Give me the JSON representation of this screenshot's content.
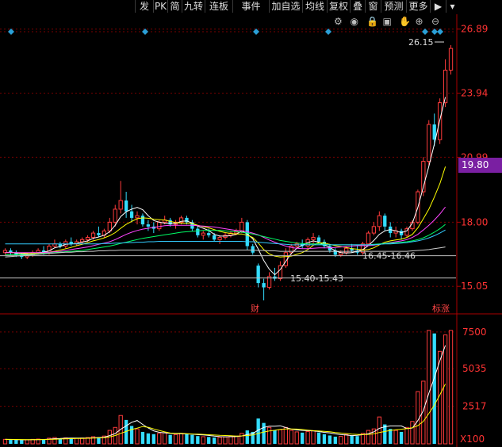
{
  "toolbar": {
    "buttons": [
      "发",
      "PK",
      "简",
      "九转",
      "连板",
      "事件",
      "加自选",
      "均线",
      "复权",
      "叠",
      "窗",
      "预测",
      "更多"
    ],
    "tools": [
      "gear-icon",
      "eye-icon",
      "lock-icon",
      "save-icon",
      "hand-icon",
      "zoom-in-icon",
      "zoom-out-icon"
    ]
  },
  "price_axis": {
    "labels": [
      "26.89",
      "23.94",
      "20.99",
      "18.00",
      "15.05"
    ],
    "current_price": "19.80"
  },
  "volume_axis": {
    "labels": [
      "7500",
      "5035",
      "2517"
    ],
    "unit": "X100"
  },
  "annotations": {
    "high": "26.15",
    "gap_upper": "16.45-16.46",
    "gap_lower": "15.40-15.43",
    "event_mark_1": "财",
    "event_mark_2": "标涨"
  },
  "colors": {
    "up": "#ff3b3b",
    "down": "#33ddff",
    "grid": "#8a0000",
    "ma5": "#ffffff",
    "ma10": "#ffff00",
    "ma20": "#ff44ff",
    "ma30": "#00ff66",
    "ma60": "#33ccff",
    "ma120": "#cccccc"
  },
  "chart_data": {
    "type": "candlestick",
    "ylim": [
      14.0,
      27.5
    ],
    "volume_ylim": [
      0,
      8500
    ],
    "candles": [
      [
        16.6,
        16.8,
        16.5,
        16.7
      ],
      [
        16.7,
        16.8,
        16.5,
        16.6
      ],
      [
        16.6,
        16.7,
        16.4,
        16.5
      ],
      [
        16.5,
        16.6,
        16.3,
        16.4
      ],
      [
        16.4,
        16.6,
        16.3,
        16.5
      ],
      [
        16.5,
        16.7,
        16.4,
        16.6
      ],
      [
        16.6,
        16.8,
        16.5,
        16.7
      ],
      [
        16.7,
        16.9,
        16.5,
        16.6
      ],
      [
        16.6,
        17.0,
        16.5,
        16.9
      ],
      [
        16.9,
        17.2,
        16.8,
        17.0
      ],
      [
        17.0,
        17.1,
        16.8,
        16.9
      ],
      [
        16.9,
        17.2,
        16.8,
        17.1
      ],
      [
        17.1,
        17.3,
        16.9,
        17.0
      ],
      [
        17.0,
        17.2,
        16.9,
        17.1
      ],
      [
        17.1,
        17.3,
        17.0,
        17.2
      ],
      [
        17.2,
        17.4,
        17.1,
        17.3
      ],
      [
        17.3,
        17.6,
        17.2,
        17.5
      ],
      [
        17.5,
        17.8,
        17.3,
        17.4
      ],
      [
        17.4,
        17.7,
        17.3,
        17.6
      ],
      [
        17.6,
        18.2,
        17.5,
        18.0
      ],
      [
        18.0,
        18.8,
        17.8,
        18.6
      ],
      [
        18.6,
        19.9,
        18.4,
        19.0
      ],
      [
        19.0,
        19.4,
        18.2,
        18.5
      ],
      [
        18.5,
        18.8,
        18.0,
        18.2
      ],
      [
        18.2,
        18.5,
        17.9,
        18.3
      ],
      [
        18.3,
        18.4,
        17.8,
        17.9
      ],
      [
        17.9,
        18.1,
        17.6,
        17.8
      ],
      [
        17.8,
        18.0,
        17.5,
        17.7
      ],
      [
        17.7,
        18.1,
        17.6,
        18.0
      ],
      [
        18.0,
        18.3,
        17.9,
        18.1
      ],
      [
        18.1,
        18.2,
        17.8,
        17.9
      ],
      [
        17.9,
        18.1,
        17.7,
        18.0
      ],
      [
        18.0,
        18.3,
        17.9,
        18.2
      ],
      [
        18.2,
        18.3,
        17.9,
        18.0
      ],
      [
        18.0,
        18.1,
        17.6,
        17.7
      ],
      [
        17.7,
        17.8,
        17.3,
        17.4
      ],
      [
        17.4,
        17.6,
        17.2,
        17.5
      ],
      [
        17.5,
        17.7,
        17.3,
        17.4
      ],
      [
        17.4,
        17.5,
        17.1,
        17.2
      ],
      [
        17.2,
        17.4,
        17.0,
        17.3
      ],
      [
        17.3,
        17.5,
        17.2,
        17.4
      ],
      [
        17.4,
        17.6,
        17.3,
        17.5
      ],
      [
        17.5,
        17.7,
        17.4,
        17.6
      ],
      [
        17.6,
        18.2,
        17.5,
        18.0
      ],
      [
        18.0,
        18.1,
        16.7,
        16.9
      ],
      [
        16.9,
        17.0,
        16.5,
        16.6
      ],
      [
        16.0,
        16.1,
        15.0,
        15.2
      ],
      [
        15.2,
        15.4,
        14.4,
        15.0
      ],
      [
        15.0,
        15.7,
        14.9,
        15.5
      ],
      [
        15.5,
        15.9,
        15.3,
        15.4
      ],
      [
        15.4,
        16.2,
        15.3,
        16.0
      ],
      [
        16.0,
        16.8,
        15.9,
        16.6
      ],
      [
        16.6,
        17.0,
        16.5,
        16.9
      ],
      [
        16.9,
        17.1,
        16.8,
        17.0
      ],
      [
        17.0,
        17.2,
        16.8,
        16.9
      ],
      [
        16.9,
        17.3,
        16.8,
        17.2
      ],
      [
        17.2,
        17.5,
        17.0,
        17.3
      ],
      [
        17.3,
        17.4,
        17.0,
        17.1
      ],
      [
        17.1,
        17.2,
        16.8,
        16.9
      ],
      [
        16.9,
        17.0,
        16.6,
        16.7
      ],
      [
        16.7,
        16.8,
        16.4,
        16.5
      ],
      [
        16.5,
        16.7,
        16.4,
        16.6
      ],
      [
        16.6,
        16.9,
        16.5,
        16.8
      ],
      [
        16.8,
        17.0,
        16.6,
        16.7
      ],
      [
        16.7,
        16.9,
        16.5,
        16.6
      ],
      [
        16.6,
        17.1,
        16.5,
        17.0
      ],
      [
        17.0,
        17.6,
        16.9,
        17.5
      ],
      [
        17.5,
        18.0,
        17.4,
        17.8
      ],
      [
        17.8,
        18.5,
        17.6,
        18.3
      ],
      [
        18.3,
        18.4,
        17.6,
        17.8
      ],
      [
        17.8,
        18.0,
        17.3,
        17.5
      ],
      [
        17.5,
        17.8,
        17.3,
        17.6
      ],
      [
        17.6,
        17.7,
        17.2,
        17.4
      ],
      [
        17.4,
        17.8,
        17.3,
        17.7
      ],
      [
        17.7,
        18.1,
        17.6,
        18.0
      ],
      [
        18.0,
        19.5,
        17.9,
        19.4
      ],
      [
        19.4,
        21.0,
        19.2,
        20.8
      ],
      [
        20.8,
        22.7,
        20.6,
        22.5
      ],
      [
        22.5,
        23.0,
        21.5,
        21.8
      ],
      [
        21.8,
        23.7,
        21.6,
        23.5
      ],
      [
        23.5,
        25.5,
        23.3,
        25.0
      ],
      [
        25.0,
        26.15,
        24.8,
        26.0
      ]
    ],
    "volumes": [
      300,
      280,
      260,
      250,
      270,
      300,
      320,
      310,
      380,
      420,
      360,
      400,
      350,
      370,
      390,
      420,
      480,
      450,
      520,
      900,
      1100,
      1900,
      1600,
      1200,
      1000,
      800,
      700,
      650,
      700,
      750,
      600,
      620,
      700,
      650,
      600,
      520,
      480,
      460,
      420,
      440,
      460,
      500,
      520,
      700,
      900,
      800,
      1700,
      1400,
      1100,
      900,
      950,
      1100,
      900,
      800,
      750,
      820,
      880,
      760,
      640,
      560,
      480,
      500,
      620,
      560,
      520,
      700,
      900,
      1000,
      1800,
      1300,
      1000,
      900,
      800,
      1100,
      1500,
      3500,
      4200,
      7600,
      7400,
      6200,
      7300,
      7600
    ],
    "ma_series": [
      {
        "color": "#ffffff",
        "values": [
          16.6,
          16.62,
          16.58,
          16.54,
          16.54,
          16.56,
          16.6,
          16.62,
          16.68,
          16.82,
          16.88,
          16.98,
          17.0,
          17.02,
          17.08,
          17.14,
          17.26,
          17.32,
          17.4,
          17.56,
          17.86,
          18.26,
          18.48,
          18.6,
          18.68,
          18.58,
          18.3,
          18.08,
          18.0,
          17.96,
          17.94,
          17.94,
          18.04,
          18.06,
          17.96,
          17.82,
          17.72,
          17.62,
          17.44,
          17.36,
          17.36,
          17.38,
          17.44,
          17.6,
          17.46,
          17.24,
          16.76,
          16.24,
          15.84,
          15.58,
          15.82,
          16.2,
          16.56,
          16.8,
          16.94,
          17.06,
          17.14,
          17.08,
          16.96,
          16.84,
          16.68,
          16.6,
          16.58,
          16.6,
          16.66,
          16.74,
          16.92,
          17.16,
          17.44,
          17.6,
          17.66,
          17.6,
          17.52,
          17.6,
          17.96,
          18.68,
          19.62,
          20.58,
          21.6,
          22.72,
          23.76
        ]
      },
      {
        "color": "#ffff00",
        "values": [
          16.6,
          16.6,
          16.6,
          16.58,
          16.56,
          16.56,
          16.58,
          16.6,
          16.62,
          16.66,
          16.72,
          16.78,
          16.84,
          16.92,
          16.98,
          17.06,
          17.14,
          17.2,
          17.28,
          17.38,
          17.52,
          17.72,
          17.9,
          18.04,
          18.16,
          18.2,
          18.18,
          18.14,
          18.12,
          18.1,
          18.04,
          17.98,
          17.96,
          17.96,
          17.94,
          17.86,
          17.8,
          17.74,
          17.66,
          17.58,
          17.52,
          17.48,
          17.46,
          17.46,
          17.4,
          17.3,
          17.04,
          16.74,
          16.54,
          16.44,
          16.4,
          16.42,
          16.44,
          16.52,
          16.6,
          16.74,
          16.94,
          17.06,
          17.04,
          16.98,
          16.92,
          16.88,
          16.84,
          16.78,
          16.76,
          16.72,
          16.74,
          16.82,
          16.96,
          17.08,
          17.14,
          17.18,
          17.22,
          17.3,
          17.44,
          17.74,
          18.16,
          18.6,
          19.16,
          19.78,
          20.56
        ]
      },
      {
        "color": "#ff44ff",
        "values": [
          16.6,
          16.6,
          16.6,
          16.6,
          16.6,
          16.6,
          16.6,
          16.6,
          16.62,
          16.64,
          16.66,
          16.7,
          16.74,
          16.78,
          16.82,
          16.86,
          16.92,
          16.98,
          17.04,
          17.1,
          17.2,
          17.32,
          17.44,
          17.54,
          17.62,
          17.68,
          17.72,
          17.76,
          17.8,
          17.84,
          17.86,
          17.86,
          17.86,
          17.86,
          17.86,
          17.84,
          17.82,
          17.8,
          17.78,
          17.74,
          17.7,
          17.66,
          17.62,
          17.6,
          17.56,
          17.5,
          17.42,
          17.3,
          17.18,
          17.08,
          16.98,
          16.9,
          16.84,
          16.8,
          16.78,
          16.78,
          16.8,
          16.82,
          16.82,
          16.82,
          16.84,
          16.86,
          16.88,
          16.9,
          16.92,
          16.92,
          16.92,
          16.94,
          16.98,
          17.02,
          17.06,
          17.1,
          17.14,
          17.2,
          17.3,
          17.44,
          17.64,
          17.86,
          18.1,
          18.38,
          18.7
        ]
      },
      {
        "color": "#00ff66",
        "values": [
          16.5,
          16.5,
          16.5,
          16.5,
          16.5,
          16.52,
          16.54,
          16.56,
          16.58,
          16.6,
          16.62,
          16.64,
          16.66,
          16.68,
          16.7,
          16.74,
          16.78,
          16.82,
          16.86,
          16.9,
          16.96,
          17.02,
          17.08,
          17.14,
          17.2,
          17.26,
          17.3,
          17.34,
          17.38,
          17.42,
          17.46,
          17.5,
          17.54,
          17.56,
          17.58,
          17.6,
          17.62,
          17.62,
          17.62,
          17.62,
          17.6,
          17.58,
          17.56,
          17.54,
          17.5,
          17.46,
          17.4,
          17.34,
          17.28,
          17.22,
          17.16,
          17.12,
          17.08,
          17.04,
          17.02,
          17.0,
          17.0,
          17.0,
          16.98,
          16.96,
          16.96,
          16.96,
          16.96,
          16.96,
          16.96,
          16.96,
          16.96,
          16.98,
          17.0,
          17.02,
          17.04,
          17.06,
          17.08,
          17.1,
          17.14,
          17.2,
          17.28,
          17.4,
          17.54,
          17.7,
          17.9
        ]
      },
      {
        "color": "#33ccff",
        "values": [
          17.0,
          17.0,
          17.0,
          17.0,
          17.0,
          17.0,
          17.0,
          17.0,
          17.0,
          17.0,
          17.0,
          17.0,
          17.0,
          17.0,
          17.0,
          17.0,
          17.0,
          17.0,
          17.02,
          17.02,
          17.04,
          17.04,
          17.06,
          17.06,
          17.08,
          17.08,
          17.1,
          17.1,
          17.12,
          17.12,
          17.12,
          17.12,
          17.12,
          17.12,
          17.12,
          17.12,
          17.12,
          17.12,
          17.12,
          17.12,
          17.12,
          17.12,
          17.12,
          17.12,
          17.1,
          17.1,
          17.08,
          17.06,
          17.04,
          17.02,
          17.0,
          16.98,
          16.96,
          16.96,
          16.96,
          16.96,
          16.96,
          16.96,
          16.96,
          16.96,
          16.96,
          16.96,
          16.96,
          16.96,
          16.96,
          16.96,
          16.96,
          16.96,
          16.98,
          17.0,
          17.0,
          17.02,
          17.04,
          17.06,
          17.1,
          17.14,
          17.2,
          17.28,
          17.38,
          17.5,
          17.64
        ]
      },
      {
        "color": "#cccccc",
        "values": [
          16.4,
          16.42,
          16.44,
          16.46,
          16.48,
          16.5,
          16.52,
          16.54,
          16.56,
          16.58,
          16.6,
          16.62,
          16.62,
          16.64,
          16.64,
          16.66,
          16.66,
          16.68,
          16.68,
          16.7,
          16.7,
          16.72,
          16.72,
          16.72,
          16.72,
          16.72,
          16.72,
          16.72,
          16.72,
          16.72,
          16.72,
          16.72,
          16.72,
          16.72,
          16.72,
          16.72,
          16.72,
          16.72,
          16.72,
          16.72,
          16.72,
          16.72,
          16.72,
          16.72,
          16.72,
          16.72,
          16.7,
          16.7,
          16.68,
          16.68,
          16.66,
          16.66,
          16.66,
          16.66,
          16.66,
          16.66,
          16.66,
          16.66,
          16.66,
          16.66,
          16.66,
          16.66,
          16.66,
          16.66,
          16.66,
          16.66,
          16.66,
          16.66,
          16.66,
          16.66,
          16.66,
          16.66,
          16.66,
          16.66,
          16.68,
          16.7,
          16.72,
          16.74,
          16.78,
          16.82,
          16.86
        ]
      }
    ],
    "vol_ma_series": [
      {
        "color": "#ffffff",
        "values": [
          300,
          290,
          280,
          272,
          272,
          276,
          280,
          290,
          312,
          346,
          358,
          378,
          382,
          382,
          380,
          386,
          402,
          422,
          442,
          554,
          690,
          970,
          1204,
          1444,
          1560,
          1300,
          1060,
          870,
          770,
          740,
          700,
          686,
          678,
          664,
          654,
          618,
          594,
          562,
          516,
          482,
          472,
          476,
          484,
          524,
          620,
          684,
          924,
          1102,
          1182,
          1180,
          1210,
          1090,
          990,
          930,
          900,
          880,
          862,
          822,
          770,
          732,
          668,
          616,
          592,
          552,
          576,
          618,
          680,
          800,
          1040,
          1140,
          1200,
          1200,
          1200,
          1020,
          1060,
          1560,
          2220,
          3400,
          4440,
          5580,
          6600
        ]
      },
      {
        "color": "#ffff00",
        "values": [
          300,
          295,
          290,
          285,
          282,
          283,
          285,
          287,
          295,
          310,
          322,
          335,
          345,
          355,
          362,
          372,
          384,
          398,
          414,
          470,
          560,
          700,
          830,
          960,
          1050,
          1160,
          1110,
          1000,
          900,
          800,
          720,
          700,
          700,
          680,
          660,
          650,
          630,
          610,
          590,
          570,
          560,
          540,
          520,
          530,
          560,
          590,
          700,
          790,
          860,
          910,
          970,
          1000,
          1000,
          990,
          960,
          920,
          880,
          860,
          840,
          810,
          760,
          720,
          690,
          650,
          630,
          620,
          630,
          670,
          760,
          830,
          900,
          940,
          980,
          1020,
          1080,
          1220,
          1510,
          2040,
          2600,
          3290,
          4010
        ]
      }
    ]
  }
}
